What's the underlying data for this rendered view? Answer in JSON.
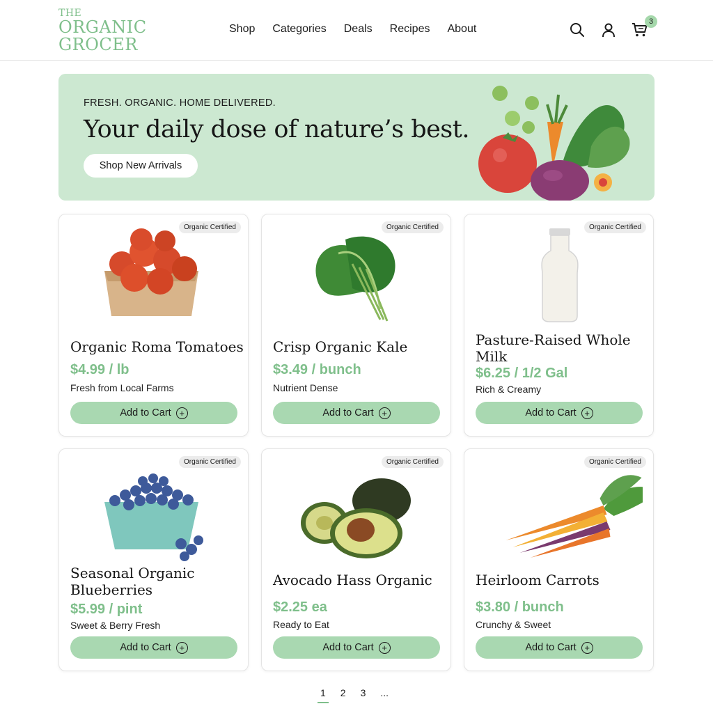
{
  "brand": {
    "line1": "THE",
    "line2": "ORGANIC",
    "line3": "GROCER",
    "color": "#7fbf8b"
  },
  "nav": [
    "Shop",
    "Categories",
    "Deals",
    "Recipes",
    "About"
  ],
  "header_icons": {
    "search": "search-icon",
    "account": "user-icon",
    "cart": "cart-icon",
    "cart_count": "3"
  },
  "hero": {
    "kicker": "FRESH. ORGANIC. HOME DELIVERED.",
    "headline": "Your daily dose of nature’s best.",
    "cta": "Shop New Arrivals",
    "bg": "#cce8d1"
  },
  "products": [
    {
      "tag": "Organic Certified",
      "name": "Organic Roma Tomatoes",
      "price": "$4.99 / lb",
      "desc": "Fresh from Local Farms",
      "cta": "Add to Cart"
    },
    {
      "tag": "Organic Certified",
      "name": "Crisp Organic Kale",
      "price": "$3.49 / bunch",
      "desc": "Nutrient Dense",
      "cta": "Add to Cart"
    },
    {
      "tag": "Organic Certified",
      "name": "Pasture-Raised Whole Milk",
      "price": "$6.25 / 1/2 Gal",
      "desc": "Rich & Creamy",
      "cta": "Add to Cart"
    },
    {
      "tag": "Organic Certified",
      "name": "Seasonal Organic Blueberries",
      "price": "$5.99 / pint",
      "desc": "Sweet & Berry Fresh",
      "cta": "Add to Cart"
    },
    {
      "tag": "Organic Certified",
      "name": "Avocado Hass Organic",
      "price": "$2.25 ea",
      "desc": "Ready to Eat",
      "cta": "Add to Cart"
    },
    {
      "tag": "Organic Certified",
      "name": "Heirloom Carrots",
      "price": "$3.80 / bunch",
      "desc": "Crunchy & Sweet",
      "cta": "Add to Cart"
    }
  ],
  "pagination": [
    "1",
    "2",
    "3",
    "..."
  ],
  "colors": {
    "accent": "#7fbf8b",
    "button": "#a9d8b1"
  }
}
